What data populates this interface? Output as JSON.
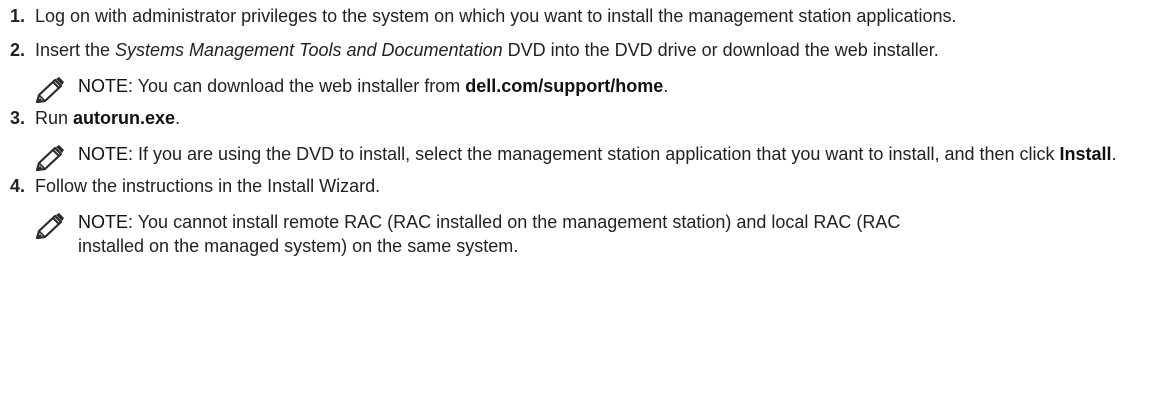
{
  "steps": [
    {
      "number": "1.",
      "text": "Log on with administrator privileges to the system on which you want to install the management station applications."
    },
    {
      "number": "2.",
      "text_before": "Insert the ",
      "text_italic": "Systems Management Tools and Documentation",
      "text_after": " DVD into the DVD drive or download the web installer.",
      "note": {
        "label": "NOTE:",
        "text_before": " You can download the web installer from ",
        "text_bold": "dell.com/support/home",
        "text_after": "."
      }
    },
    {
      "number": "3.",
      "text_before": "Run ",
      "text_bold": "autorun.exe",
      "text_after": ".",
      "note": {
        "label": "NOTE:",
        "text_before": " If you are using the DVD to install, select the management station application that you want to install, and then click ",
        "text_bold": "Install",
        "text_after": "."
      }
    },
    {
      "number": "4.",
      "text": "Follow the instructions in the Install Wizard.",
      "note": {
        "label": "NOTE:",
        "text": " You cannot install remote RAC (RAC installed on the management station) and local RAC (RAC installed on the managed system) on the same system."
      }
    }
  ],
  "icons": {
    "note": "pencil-note-icon"
  }
}
